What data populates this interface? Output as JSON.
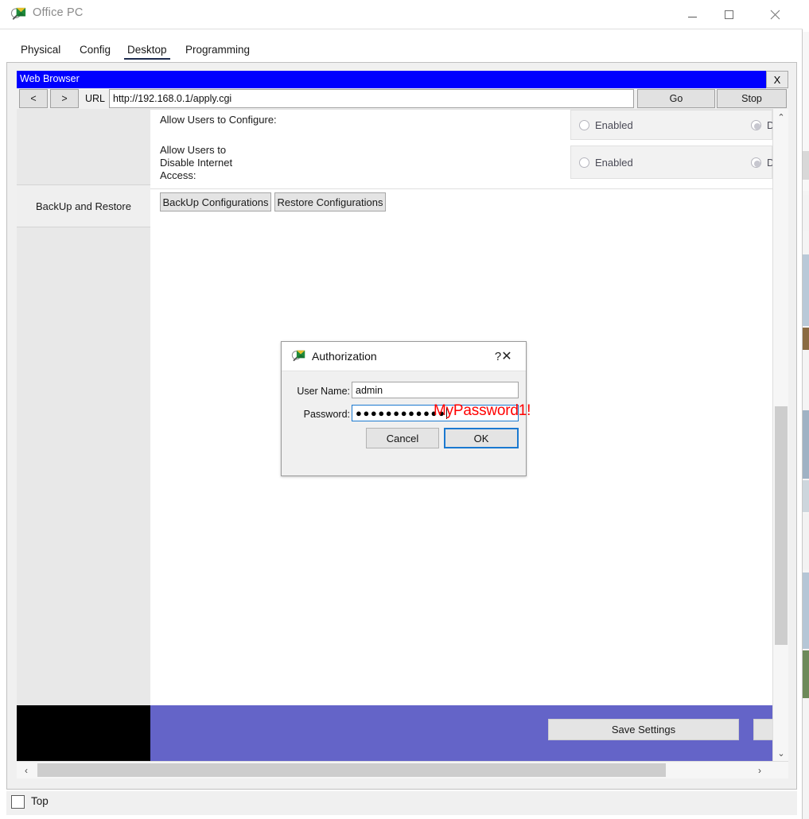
{
  "window": {
    "title": "Office PC",
    "icon": "packet-tracer-icon",
    "controls": {
      "minimize": "minimize-icon",
      "maximize": "maximize-icon",
      "close": "close-icon"
    }
  },
  "tabs": [
    {
      "label": "Physical",
      "active": false
    },
    {
      "label": "Config",
      "active": false
    },
    {
      "label": "Desktop",
      "active": true
    },
    {
      "label": "Programming",
      "active": false
    }
  ],
  "browser": {
    "title": "Web Browser",
    "close_label": "X",
    "back_label": "<",
    "forward_label": ">",
    "url_label": "URL",
    "url_value": "http://192.168.0.1/apply.cgi",
    "go_label": "Go",
    "stop_label": "Stop"
  },
  "page": {
    "sidebar": {
      "selected_item": "BackUp and Restore"
    },
    "rows": [
      {
        "label": "Allow Users to Configure:",
        "options": [
          {
            "label": "Enabled",
            "selected": false
          },
          {
            "label": "Disabled",
            "selected": true
          }
        ]
      },
      {
        "label": "Allow Users to\nDisable Internet\nAccess:",
        "options": [
          {
            "label": "Enabled",
            "selected": false
          },
          {
            "label": "Disabled",
            "selected": true
          }
        ]
      }
    ],
    "buttons": {
      "backup": "BackUp Configurations",
      "restore": "Restore Configurations"
    },
    "footer": {
      "save_label": "Save Settings",
      "accent_color": "#6464c8"
    }
  },
  "dialog": {
    "title": "Authorization",
    "icon": "packet-tracer-icon",
    "help_label": "?",
    "close_label": "✕",
    "username_label": "User Name:",
    "username_value": "admin",
    "password_label": "Password:",
    "password_masked": "●●●●●●●●●●●●",
    "password_annotation": "MyPassword1!",
    "annotation_color": "#ff0000",
    "cancel_label": "Cancel",
    "ok_label": "OK"
  },
  "statusbar": {
    "top_checkbox_label": "Top",
    "top_checkbox_checked": false
  },
  "scroll": {
    "vertical_up": "⌃",
    "vertical_down": "⌄",
    "horizontal_left": "‹",
    "horizontal_right": "›"
  }
}
